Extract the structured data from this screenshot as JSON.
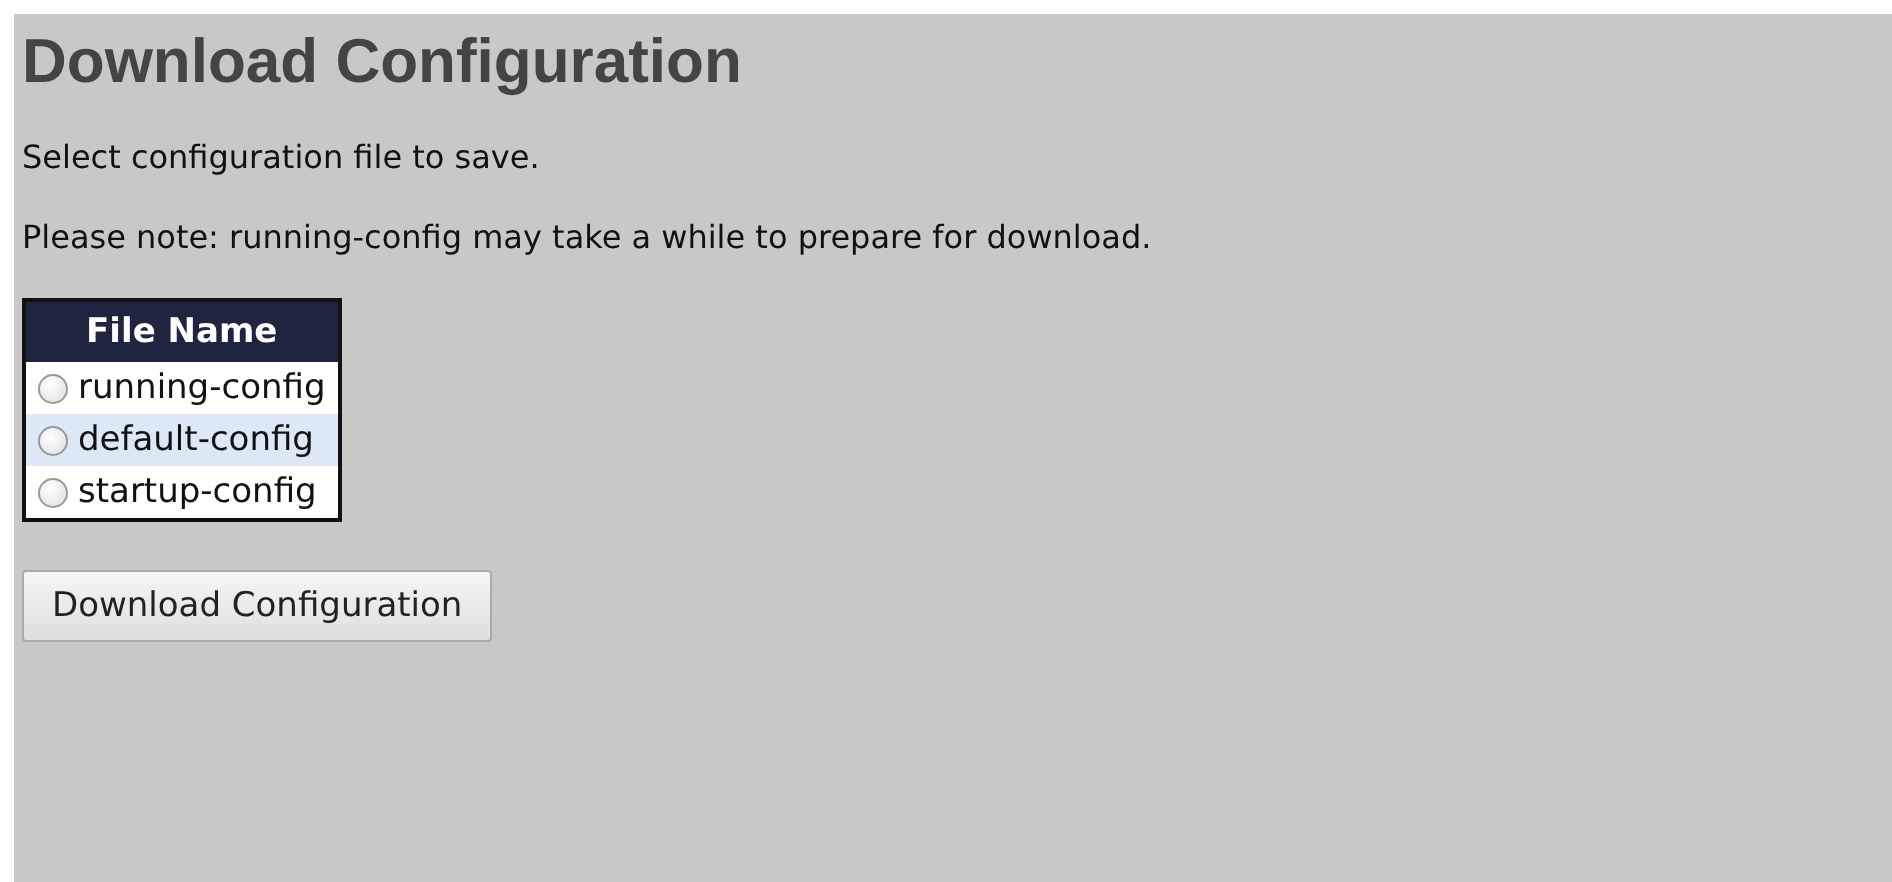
{
  "title": "Download Configuration",
  "instructions": [
    "Select configuration file to save.",
    "Please note: running-config may take a while to prepare for download."
  ],
  "table": {
    "column": "File Name",
    "rows": [
      {
        "name": "running-config",
        "selected": false
      },
      {
        "name": "default-config",
        "selected": false
      },
      {
        "name": "startup-config",
        "selected": false
      }
    ]
  },
  "button": "Download Configuration"
}
